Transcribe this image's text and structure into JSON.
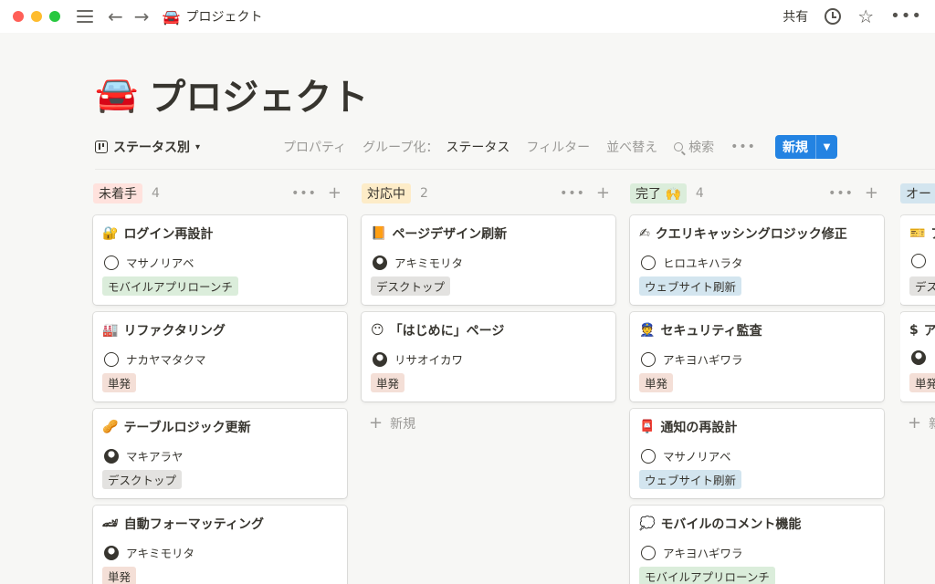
{
  "titlebar": {
    "breadcrumb_emoji": "🚘",
    "breadcrumb_title": "プロジェクト",
    "share_label": "共有",
    "icons": [
      "hamburger-icon",
      "back-arrow-icon",
      "forward-arrow-icon",
      "clock-icon",
      "star-icon",
      "more-icon"
    ]
  },
  "page": {
    "emoji": "🚘",
    "title": "プロジェクト"
  },
  "toolbar": {
    "view_label": "ステータス別",
    "properties": "プロパティ",
    "group_label": "グループ化：",
    "group_value": "ステータス",
    "filter": "フィルター",
    "sort": "並べ替え",
    "search": "検索",
    "more": "•••",
    "new_label": "新規"
  },
  "columns": [
    {
      "status": "未着手",
      "color": "#ffe2dd",
      "count": "4",
      "cards": [
        {
          "emoji": "🔐",
          "title": "ログイン再設計",
          "person": "マサノリアベ",
          "tag": "モバイルアプリローンチ",
          "tag_type": "mobile"
        },
        {
          "emoji": "🏭",
          "title": "リファクタリング",
          "person": "ナカヤマタクマ",
          "tag": "単発",
          "tag_type": "single"
        },
        {
          "emoji": "🥜",
          "title": "テーブルロジック更新",
          "person": "マキアラヤ",
          "tag": "デスクトップ",
          "tag_type": "desktop"
        },
        {
          "emoji": "🏎",
          "title": "自動フォーマッティング",
          "person": "アキミモリタ",
          "tag": "単発",
          "tag_type": "single"
        }
      ]
    },
    {
      "status": "対応中",
      "color": "#fdecc8",
      "count": "2",
      "cards": [
        {
          "emoji": "📙",
          "title": "ページデザイン刷新",
          "person": "アキミモリタ",
          "tag": "デスクトップ",
          "tag_type": "desktop"
        },
        {
          "emoji": "😶",
          "title": "「はじめに」ページ",
          "person": "リサオイカワ",
          "tag": "単発",
          "tag_type": "single"
        }
      ],
      "add_label": "新規"
    },
    {
      "status": "完了 🙌",
      "color": "#dbeddb",
      "count": "4",
      "cards": [
        {
          "emoji": "✍",
          "title": "クエリキャッシングロジック修正",
          "person": "ヒロユキハラタ",
          "tag": "ウェブサイト刷新",
          "tag_type": "web"
        },
        {
          "emoji": "👮",
          "title": "セキュリティ監査",
          "person": "アキヨハギワラ",
          "tag": "単発",
          "tag_type": "single"
        },
        {
          "emoji": "📮",
          "title": "通知の再設計",
          "person": "マサノリアベ",
          "tag": "ウェブサイト刷新",
          "tag_type": "web"
        },
        {
          "emoji": "💭",
          "title": "モバイルのコメント機能",
          "person": "アキヨハギワラ",
          "tag": "モバイルアプリローンチ",
          "tag_type": "mobile"
        }
      ]
    },
    {
      "status": "オー",
      "color": "#d3e5ef",
      "cards": [
        {
          "emoji": "🎫",
          "title": "ア",
          "tag": "デス",
          "tag_type": "desktop"
        },
        {
          "emoji": "$",
          "title": "ア",
          "tag": "単発",
          "tag_type": "single"
        }
      ],
      "add_label": "新"
    }
  ]
}
